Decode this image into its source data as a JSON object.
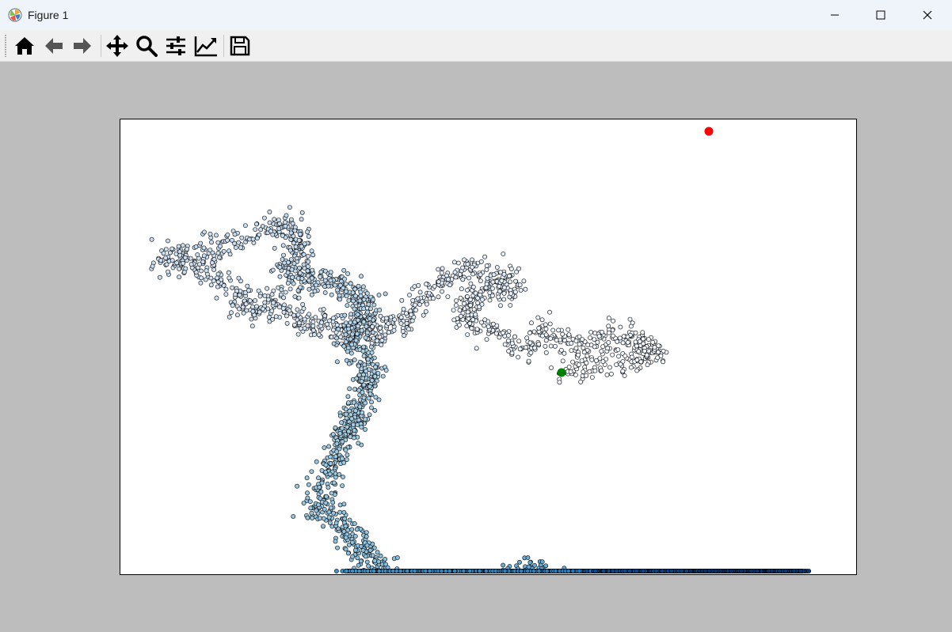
{
  "window": {
    "title": "Figure 1",
    "icon": "matplotlib-logo-icon",
    "controls": [
      "minimize-icon",
      "maximize-icon",
      "close-icon"
    ]
  },
  "toolbar": {
    "buttons": [
      {
        "name": "home-button",
        "icon": "home-icon"
      },
      {
        "name": "back-button",
        "icon": "arrow-left-icon"
      },
      {
        "name": "forward-button",
        "icon": "arrow-right-icon"
      },
      {
        "name": "pan-button",
        "icon": "move-icon"
      },
      {
        "name": "zoom-button",
        "icon": "magnifier-icon"
      },
      {
        "name": "configure-subplots-button",
        "icon": "sliders-icon"
      },
      {
        "name": "edit-axes-button",
        "icon": "line-chart-icon"
      },
      {
        "name": "save-button",
        "icon": "floppy-disk-icon"
      }
    ]
  },
  "chart_data": {
    "type": "scatter",
    "description_kind": "random-walk",
    "axes_visible": false,
    "grid": false,
    "colormap": "Blues",
    "marker_edgecolor": "#000000",
    "xlim": [
      0,
      929
    ],
    "ylim": [
      0,
      575
    ],
    "start_point": {
      "x": 557,
      "y": 128,
      "color": "#008000"
    },
    "end_point": {
      "x": 743,
      "y": 433,
      "color": "#ff0000"
    },
    "anchor_path": [
      [
        557,
        128
      ],
      [
        600,
        138
      ],
      [
        650,
        148
      ],
      [
        675,
        152
      ],
      [
        660,
        165
      ],
      [
        620,
        178
      ],
      [
        580,
        158
      ],
      [
        540,
        180
      ],
      [
        510,
        160
      ],
      [
        470,
        180
      ],
      [
        430,
        200
      ],
      [
        440,
        222
      ],
      [
        470,
        230
      ],
      [
        500,
        238
      ],
      [
        470,
        248
      ],
      [
        430,
        264
      ],
      [
        400,
        238
      ],
      [
        370,
        208
      ],
      [
        345,
        185
      ],
      [
        320,
        173
      ],
      [
        300,
        195
      ],
      [
        285,
        175
      ],
      [
        260,
        195
      ],
      [
        230,
        190
      ],
      [
        200,
        220
      ],
      [
        170,
        205
      ],
      [
        150,
        220
      ],
      [
        120,
        258
      ],
      [
        90,
        268
      ],
      [
        50,
        270
      ],
      [
        110,
        285
      ],
      [
        170,
        305
      ],
      [
        210,
        315
      ],
      [
        230,
        300
      ],
      [
        215,
        270
      ],
      [
        210,
        250
      ],
      [
        240,
        245
      ],
      [
        270,
        240
      ],
      [
        290,
        230
      ],
      [
        310,
        218
      ],
      [
        300,
        195
      ],
      [
        290,
        170
      ],
      [
        300,
        150
      ],
      [
        320,
        128
      ],
      [
        310,
        112
      ],
      [
        305,
        90
      ],
      [
        300,
        70
      ],
      [
        290,
        60
      ],
      [
        280,
        40
      ],
      [
        270,
        20
      ],
      [
        260,
        -10
      ],
      [
        240,
        -40
      ],
      [
        270,
        -50
      ],
      [
        285,
        -75
      ],
      [
        300,
        -95
      ],
      [
        320,
        -110
      ],
      [
        330,
        -130
      ],
      [
        345,
        -150
      ],
      [
        340,
        -170
      ],
      [
        360,
        -190
      ],
      [
        380,
        -200
      ],
      [
        400,
        -215
      ],
      [
        420,
        -200
      ],
      [
        440,
        -180
      ],
      [
        460,
        -170
      ],
      [
        480,
        -150
      ],
      [
        500,
        -130
      ],
      [
        520,
        -120
      ],
      [
        540,
        -140
      ],
      [
        560,
        -150
      ],
      [
        580,
        -170
      ],
      [
        555,
        -175
      ],
      [
        520,
        -160
      ],
      [
        480,
        -170
      ],
      [
        440,
        -190
      ],
      [
        420,
        -210
      ],
      [
        400,
        -235
      ],
      [
        380,
        -260
      ],
      [
        360,
        -280
      ],
      [
        330,
        -300
      ],
      [
        310,
        -290
      ],
      [
        290,
        -300
      ],
      [
        300,
        -330
      ],
      [
        330,
        -350
      ],
      [
        350,
        -380
      ],
      [
        380,
        -390
      ],
      [
        400,
        -360
      ],
      [
        420,
        -340
      ],
      [
        450,
        -355
      ],
      [
        480,
        -370
      ],
      [
        510,
        -382
      ],
      [
        540,
        -392
      ],
      [
        560,
        -385
      ],
      [
        575,
        -395
      ],
      [
        600,
        -400
      ],
      [
        620,
        -385
      ],
      [
        640,
        -375
      ],
      [
        660,
        -360
      ],
      [
        670,
        -340
      ],
      [
        690,
        -325
      ],
      [
        720,
        -330
      ],
      [
        740,
        -340
      ],
      [
        760,
        -360
      ],
      [
        780,
        -370
      ],
      [
        800,
        -382
      ],
      [
        820,
        -405
      ],
      [
        840,
        -420
      ],
      [
        850,
        -440
      ],
      [
        820,
        -430
      ],
      [
        790,
        -420
      ],
      [
        760,
        -410
      ],
      [
        730,
        -395
      ],
      [
        700,
        -378
      ],
      [
        680,
        -360
      ],
      [
        660,
        -342
      ],
      [
        640,
        -325
      ],
      [
        620,
        -315
      ],
      [
        610,
        -300
      ],
      [
        630,
        -285
      ],
      [
        660,
        -290
      ],
      [
        690,
        -300
      ],
      [
        720,
        -315
      ],
      [
        740,
        -330
      ],
      [
        760,
        -352
      ],
      [
        790,
        -368
      ],
      [
        820,
        -378
      ],
      [
        850,
        -395
      ],
      [
        830,
        -410
      ],
      [
        800,
        -420
      ],
      [
        770,
        -430
      ],
      [
        743,
        -433
      ]
    ]
  }
}
